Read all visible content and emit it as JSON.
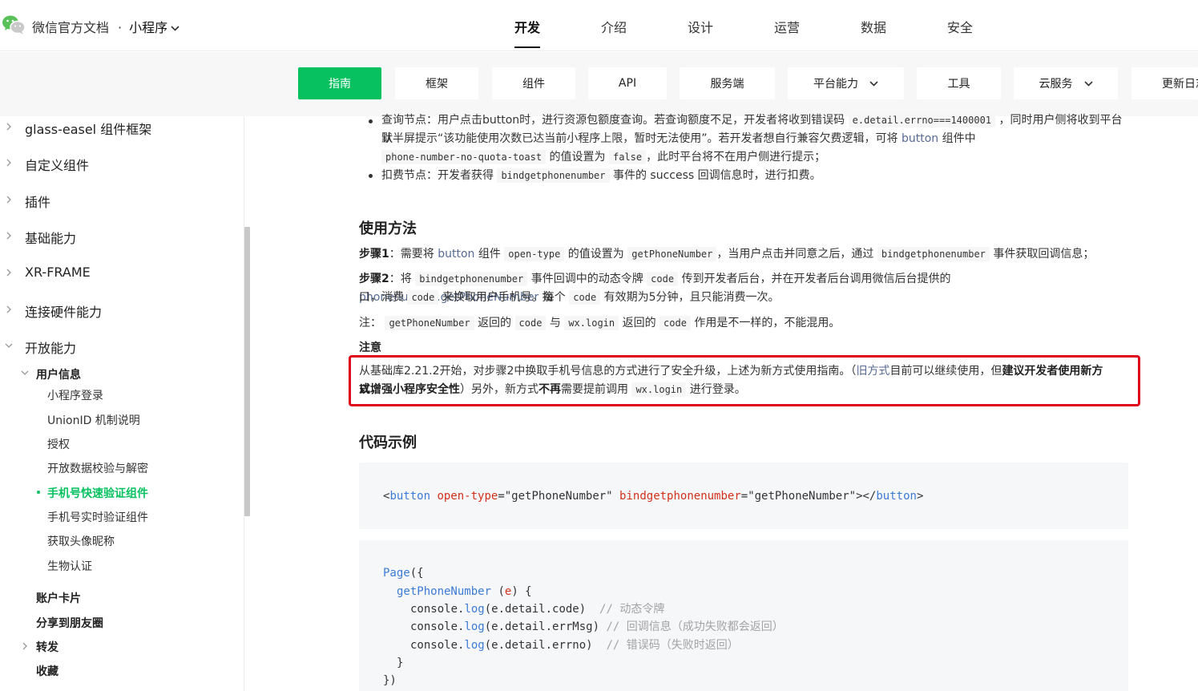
{
  "header": {
    "brand": "微信官方文档",
    "product": "小程序",
    "nav": [
      "开发",
      "介绍",
      "设计",
      "运营",
      "数据",
      "安全"
    ],
    "active_nav": "开发"
  },
  "subnav": {
    "items": [
      "指南",
      "框架",
      "组件",
      "API",
      "服务端",
      "平台能力",
      "工具",
      "云服务",
      "更新日志"
    ],
    "active": "指南",
    "accent": "#07c160"
  },
  "sidebar": {
    "l1": [
      "glass-easel 组件框架",
      "自定义组件",
      "插件",
      "基础能力",
      "XR-FRAME",
      "连接硬件能力",
      "开放能力"
    ],
    "open_section": "用户信息",
    "l3": [
      "小程序登录",
      "UnionID 机制说明",
      "授权",
      "开放数据校验与解密",
      "手机号快速验证组件",
      "手机号实时验证组件",
      "获取头像昵称",
      "生物认证"
    ],
    "current": "手机号快速验证组件",
    "after": [
      "账户卡片",
      "分享到朋友圈",
      "转发",
      "收藏"
    ]
  },
  "content": {
    "b1_a": "查询节点：用户点击button时，进行资源包额度查询。若查询额度不足，开发者将收到错误码",
    "b1_code1": "e.detail.errno===1400001",
    "b1_b": "，同时用户侧将收到平台默",
    "b1_c": "认半屏提示“该功能使用次数已达当前小程序上限，暂时无法使用”。若开发者想自行兼容欠费逻辑，可将",
    "b1_link": "button",
    "b1_d": "组件中",
    "b1_code2": "phone-number-no-quota-toast",
    "b1_e": "的值设置为",
    "b1_code3": "false",
    "b1_f": "，此时平台将不在用户侧进行提示；",
    "b2_a": "扣费节点：开发者获得",
    "b2_code": "bindgetphonenumber",
    "b2_b": "事件的 success 回调信息时，进行扣费。",
    "h_usage": "使用方法",
    "s1_label": "步骤1",
    "s1_a": "：需要将",
    "s1_link": "button",
    "s1_b": "组件",
    "s1_code1": "open-type",
    "s1_c": "的值设置为",
    "s1_code2": "getPhoneNumber",
    "s1_d": "，当用户点击并同意之后，通过",
    "s1_code3": "bindgetphonenumber",
    "s1_e": "事件获取回调信息；",
    "s2_label": "步骤2",
    "s2_a": "：将",
    "s2_code1": "bindgetphonenumber",
    "s2_b": "事件回调中的动态令牌",
    "s2_code2": "code",
    "s2_c": "传到开发者后台，并在开发者后台调用微信后台提供的",
    "s2_link": "phonenumber.getPhoneNumber",
    "s2_d": "接",
    "s2_e": "口，消费",
    "s2_code3": "code",
    "s2_f": "来换取用户手机号。每个",
    "s2_code4": "code",
    "s2_g": "有效期为5分钟，且只能消费一次。",
    "note_a": "注：",
    "note_code1": "getPhoneNumber",
    "note_b": "返回的",
    "note_code2": "code",
    "note_c": "与",
    "note_code3": "wx.login",
    "note_d": "返回的",
    "note_code4": "code",
    "note_e": "作用是不一样的，不能混用。",
    "attn_title": "注意",
    "attn_a": "从基础库2.21.2开始，对步骤2中换取手机号信息的方式进行了安全升级，上述为新方式使用指南。（",
    "attn_link": "旧方式",
    "attn_b": "目前可以继续使用，但",
    "attn_bold1": "建议开发者使用新方式，",
    "attn_bold2": "以增强小程序安全性",
    "attn_c": "）另外，新方式",
    "attn_bold3": "不再",
    "attn_d": "需要提前调用",
    "attn_code": "wx.login",
    "attn_e": "进行登录。",
    "h_code": "代码示例"
  },
  "code1": {
    "lt": "<",
    "tag": "button",
    "attr1": "open-type",
    "val1": "=\"getPhoneNumber\"",
    "attr2": "bindgetphonenumber",
    "val2": "=\"getPhoneNumber\"",
    "close_a": "></",
    "close_b": ">"
  },
  "code2": {
    "l1_fn": "Page",
    "l1_rest": "({",
    "l2_fn": "getPhoneNumber",
    "l2_a": " (",
    "l2_p": "e",
    "l2_b": ") {",
    "l3_a": "console.",
    "l3_fn": "log",
    "l3_b": "(e.detail.code)  ",
    "l3_c": "// 动态令牌",
    "l4_a": "console.",
    "l4_fn": "log",
    "l4_b": "(e.detail.errMsg) ",
    "l4_c": "// 回调信息（成功失败都会返回）",
    "l5_a": "console.",
    "l5_fn": "log",
    "l5_b": "(e.detail.errno)  ",
    "l5_c": "// 错误码（失败时返回）",
    "l6": "}",
    "l7": "})"
  }
}
